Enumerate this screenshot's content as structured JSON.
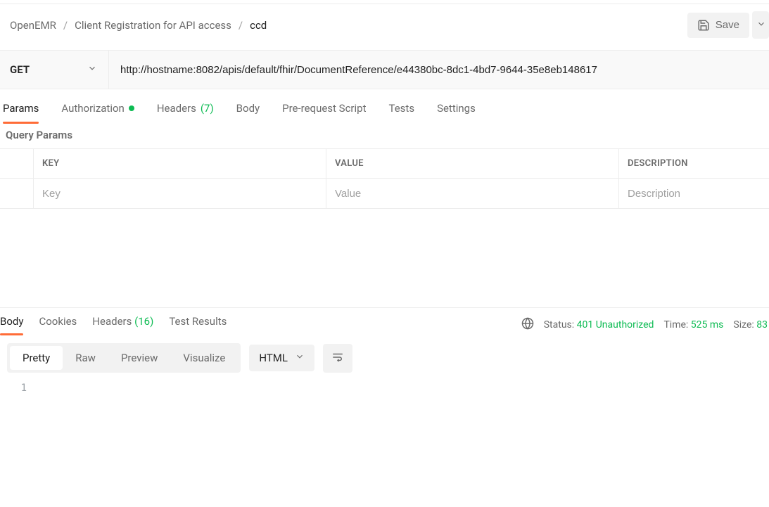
{
  "breadcrumb": [
    "OpenEMR",
    "Client Registration for API access",
    "ccd"
  ],
  "header": {
    "save_label": "Save"
  },
  "request": {
    "method": "GET",
    "url": "http://hostname:8082/apis/default/fhir/DocumentReference/e44380bc-8dc1-4bd7-9644-35e8eb148617"
  },
  "request_tabs": {
    "params": "Params",
    "authorization": "Authorization",
    "headers_label": "Headers",
    "headers_count": "(7)",
    "body": "Body",
    "prerequest": "Pre-request Script",
    "tests": "Tests",
    "settings": "Settings"
  },
  "query": {
    "title": "Query Params",
    "columns": {
      "key": "KEY",
      "value": "VALUE",
      "description": "DESCRIPTION"
    },
    "placeholders": {
      "key": "Key",
      "value": "Value",
      "description": "Description"
    }
  },
  "response_tabs": {
    "body": "Body",
    "cookies": "Cookies",
    "headers_label": "Headers",
    "headers_count": "(16)",
    "test_results": "Test Results"
  },
  "status": {
    "status_label": "Status:",
    "status_value": "401 Unauthorized",
    "time_label": "Time:",
    "time_value": "525 ms",
    "size_label": "Size:",
    "size_value": "83"
  },
  "view_modes": {
    "pretty": "Pretty",
    "raw": "Raw",
    "preview": "Preview",
    "visualize": "Visualize"
  },
  "format": "HTML",
  "code": {
    "line_number": "1",
    "content": ""
  }
}
